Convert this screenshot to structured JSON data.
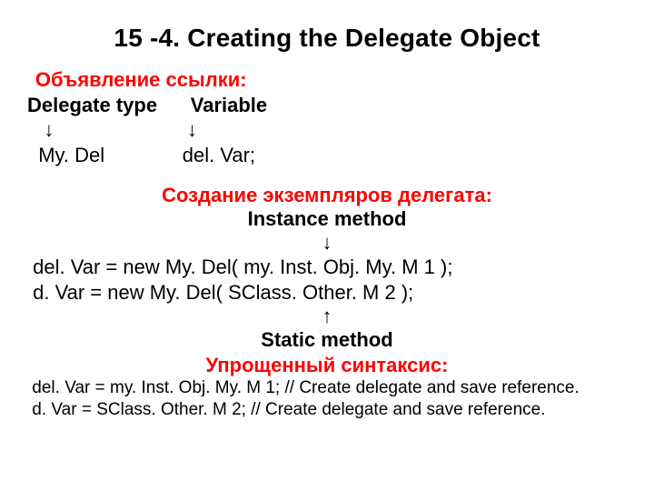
{
  "title": "15 -4. Creating the Delegate Object",
  "section1": {
    "heading": "Объявление ссылки:",
    "row_labels_type": "Delegate type",
    "row_labels_var": "Variable",
    "arrow_down": "↓",
    "code_type": "My. Del",
    "code_var": "del. Var;"
  },
  "section2": {
    "heading": "Создание экземпляров делегата:",
    "instance_method": "Instance method",
    "arrow_down": "↓",
    "code_line1": "del. Var = new My. Del( my. Inst. Obj. My. M 1 );",
    "code_line2": "d. Var = new My. Del( SClass. Other. M 2 );",
    "arrow_up": "↑",
    "static_method": "Static method"
  },
  "section3": {
    "heading": "Упрощенный синтаксис:",
    "code_line1": "del. Var = my. Inst. Obj. My. M 1; // Create delegate and save reference.",
    "code_line2": "d. Var = SClass. Other. M 2; // Create delegate and save reference."
  }
}
